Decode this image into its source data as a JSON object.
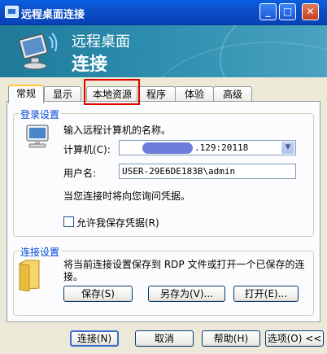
{
  "window": {
    "title": "远程桌面连接"
  },
  "banner": {
    "line1": "远程桌面",
    "line2": "连接"
  },
  "tabs": [
    {
      "label": "常规",
      "active": true
    },
    {
      "label": "显示"
    },
    {
      "label": "本地资源"
    },
    {
      "label": "程序"
    },
    {
      "label": "体验"
    },
    {
      "label": "高级"
    }
  ],
  "login": {
    "group_label": "登录设置",
    "prompt": "输入远程计算机的名称。",
    "computer_label": "计算机(C):",
    "computer_value": ".129:20118",
    "username_label": "用户名:",
    "username_value": "USER-29E6DE183B\\admin",
    "credential_note": "当您连接时将向您询问凭据。",
    "save_checkbox_label": "允许我保存凭据(R)",
    "save_checkbox_checked": false
  },
  "connection": {
    "group_label": "连接设置",
    "description": "将当前连接设置保存到 RDP 文件或打开一个已保存的连接。",
    "save_button": "保存(S)",
    "save_as_button": "另存为(V)...",
    "open_button": "打开(E)..."
  },
  "footer": {
    "connect_button": "连接(N)",
    "cancel_button": "取消",
    "help_button": "帮助(H)",
    "options_button": "选项(O) <<"
  },
  "colors": {
    "highlight": "#E00000",
    "group_label": "#0046D5"
  }
}
